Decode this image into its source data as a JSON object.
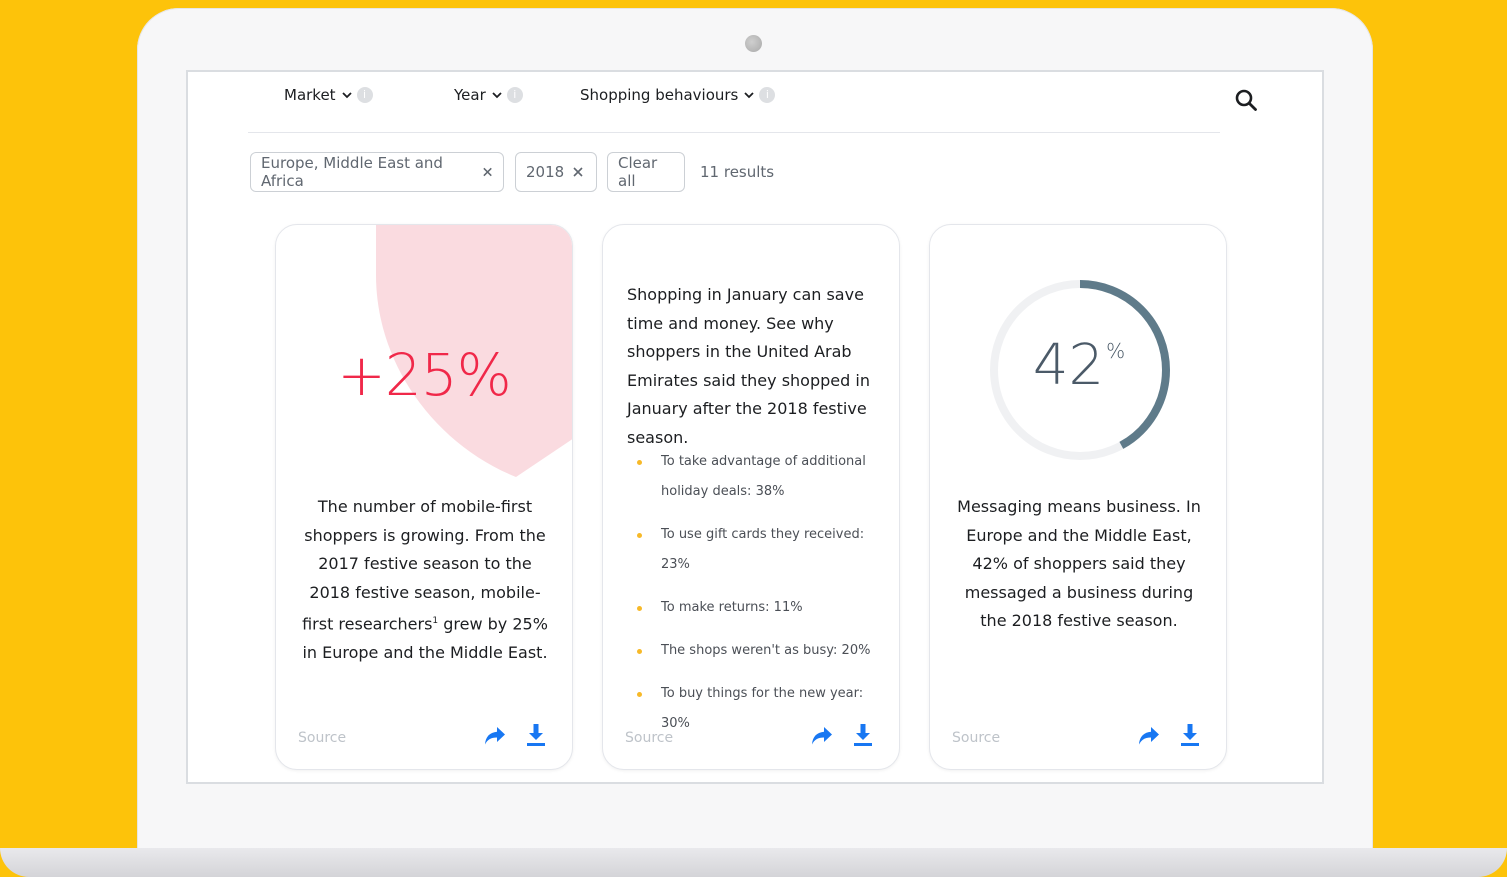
{
  "filters": {
    "market_label": "Market",
    "year_label": "Year",
    "behaviours_label": "Shopping behaviours",
    "info_glyph": "i"
  },
  "active_chips": {
    "region": "Europe, Middle East and Africa",
    "year": "2018",
    "clear_label": "Clear all",
    "results": "11 results"
  },
  "cards": [
    {
      "stat": "+25%",
      "text_pre": "The number of mobile-first shoppers is growing. From the 2017 festive season to the 2018 festive season, mobile-first researchers",
      "footnote": "1",
      "text_post": " grew by 25% in Europe and the Middle East.",
      "source": "Source"
    },
    {
      "intro": "Shopping in January can save time and money. See why shoppers in the United Arab Emirates said they shopped in January after the 2018 festive season.",
      "bullets": [
        "To take advantage of additional holiday deals: 38%",
        "To use gift cards they received: 23%",
        "To make returns: 11%",
        "The shops weren't as busy: 20%",
        "To buy things for the new year: 30%"
      ],
      "source": "Source"
    },
    {
      "stat_value": 42,
      "stat_number": "42",
      "stat_unit": "%",
      "text": "Messaging means business. In Europe and the Middle East, 42% of shoppers said they messaged a business during the 2018 festive season.",
      "source": "Source"
    }
  ],
  "colors": {
    "background": "#fdc30a",
    "stat_red": "#f02849",
    "heart_pink": "#fadbe0",
    "donut_track": "#f0f1f3",
    "donut_fill": "#5f7b8a",
    "action_blue": "#1877f2",
    "bullet_yellow": "#f7b928"
  },
  "icons": [
    "chevron-down-icon",
    "info-icon",
    "search-icon",
    "close-icon",
    "share-icon",
    "download-icon"
  ]
}
